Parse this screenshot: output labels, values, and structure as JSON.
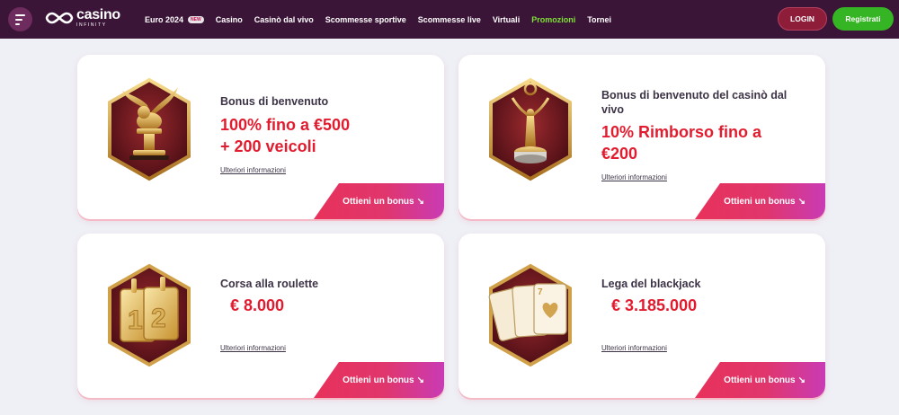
{
  "header": {
    "logo": {
      "main": "casino",
      "sub": "INFINITY"
    },
    "nav": [
      {
        "label": "Euro 2024",
        "badge": "NEW",
        "active": false
      },
      {
        "label": "Casino",
        "active": false
      },
      {
        "label": "Casinò dal vivo",
        "active": false
      },
      {
        "label": "Scommesse sportive",
        "active": false
      },
      {
        "label": "Scommesse live",
        "active": false
      },
      {
        "label": "Virtuali",
        "active": false
      },
      {
        "label": "Promozioni",
        "active": true
      },
      {
        "label": "Tornei",
        "active": false
      }
    ],
    "login_label": "LOGIN",
    "register_label": "Registrati"
  },
  "cards": [
    {
      "icon": "winged-lion-trophy-icon",
      "title": "Bonus di benvenuto",
      "amount": "100% fino a €500\n+ 200 veicoli",
      "link": "Ulteriori informazioni",
      "cta": "Ottieni un bonus",
      "arrow": "↘"
    },
    {
      "icon": "statuette-trophy-icon",
      "title": "Bonus di benvenuto del casinò dal vivo",
      "amount": "10% Rimborso fino a\n€200",
      "link": "Ulteriori informazioni",
      "cta": "Ottieni un bonus",
      "arrow": "↘"
    },
    {
      "icon": "roulette-numbers-icon",
      "title": "Corsa alla roulette",
      "amount": "€ 8.000",
      "link": "Ulteriori informazioni",
      "cta": "Ottieni un bonus",
      "arrow": "↘"
    },
    {
      "icon": "playing-cards-icon",
      "title": "Lega del blackjack",
      "amount": "€ 3.185.000",
      "link": "Ulteriori informazioni",
      "cta": "Ottieni un bonus",
      "arrow": "↘"
    }
  ],
  "colors": {
    "header_bg": "#3b1537",
    "accent_red": "#e21c2f",
    "active_nav": "#7ee039",
    "register_green": "#35b524",
    "login_bg": "#8e1d39"
  }
}
